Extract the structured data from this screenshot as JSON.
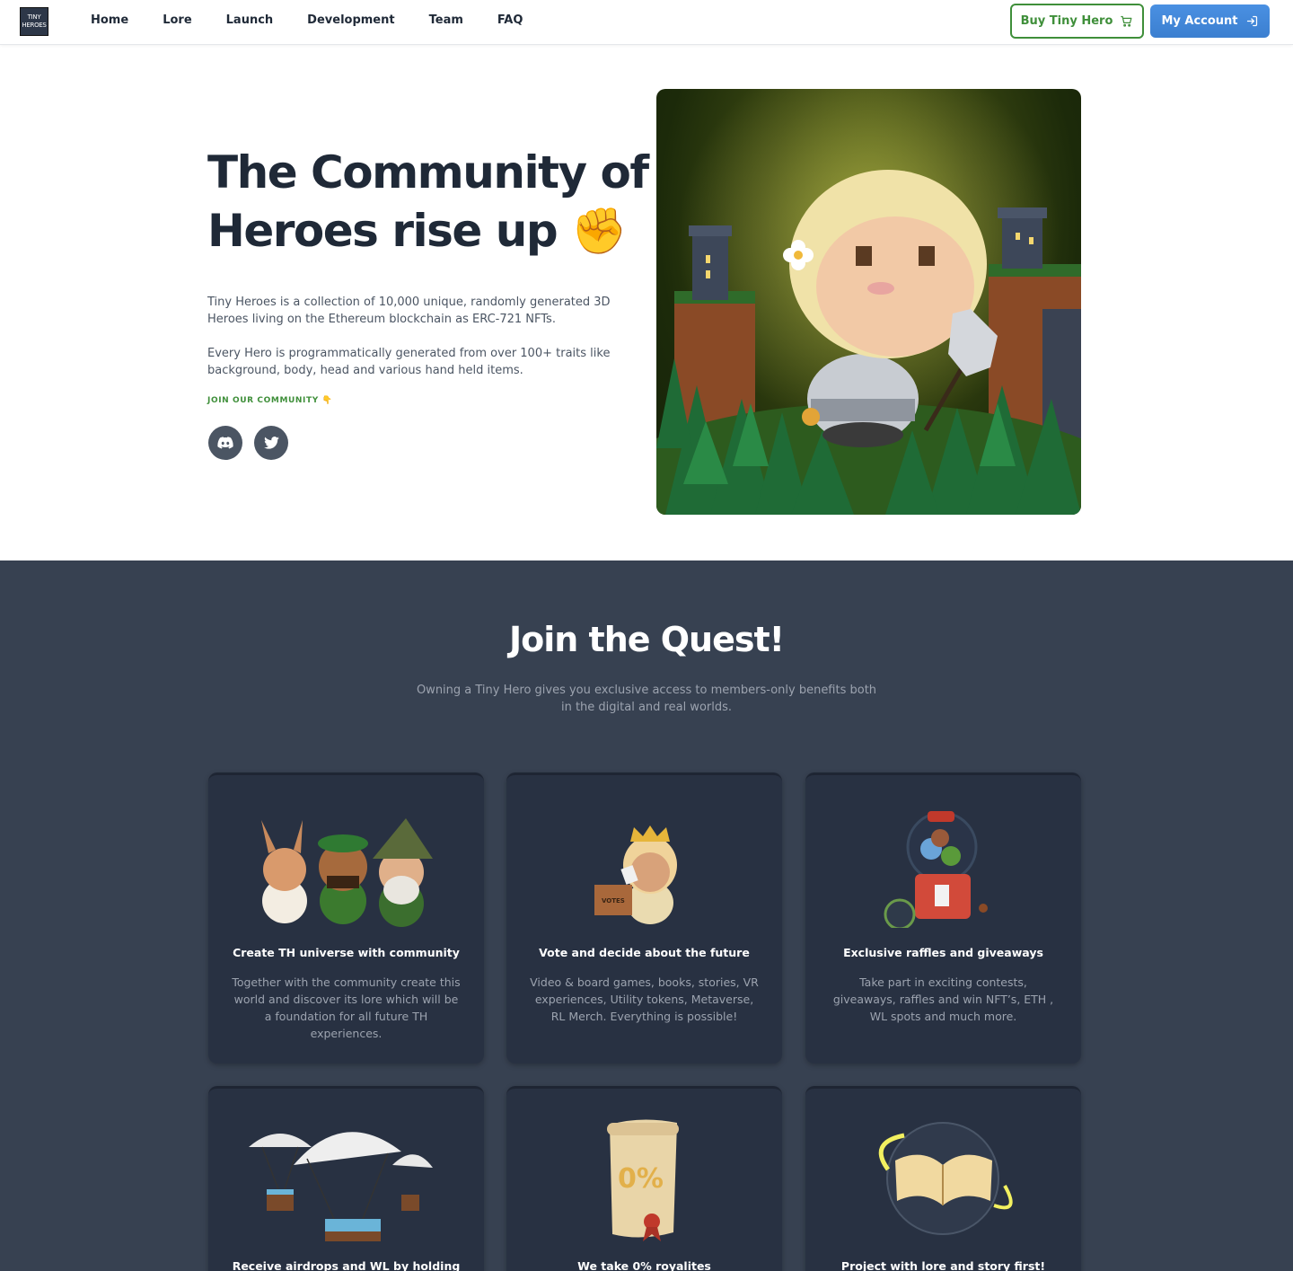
{
  "nav": {
    "logo_lines": [
      "TINY",
      "HEROES"
    ],
    "links": [
      "Home",
      "Lore",
      "Launch",
      "Development",
      "Team",
      "FAQ"
    ],
    "buy_label": "Buy Tiny Hero",
    "account_label": "My Account"
  },
  "hero": {
    "title": "The Community of Heroes rise up ✊",
    "paragraph1": "Tiny Heroes is a collection of 10,000 unique, randomly generated 3D Heroes living on the Ethereum blockchain as ERC-721 NFTs.",
    "paragraph2": "Every Hero is programmatically generated from over 100+ traits like background, body, head and various hand held items.",
    "join_label": "JOIN OUR COMMUNITY 👇",
    "socials": [
      "discord-icon",
      "twitter-icon"
    ]
  },
  "quest": {
    "title": "Join the Quest!",
    "subtitle": "Owning a Tiny Hero gives you exclusive access to members-only benefits both in the digital and real worlds.",
    "cards": [
      {
        "title": "Create TH universe with community",
        "text": "Together with the community create this world and discover its lore which will be a foundation for all future TH experiences."
      },
      {
        "title": "Vote and decide about the future",
        "text": "Video & board games, books, stories, VR experiences, Utility tokens, Metaverse, RL Merch. Everything is possible!",
        "art_label": "VOTES"
      },
      {
        "title": "Exclusive raffles and giveaways",
        "text": "Take part in exciting contests, giveaways, raffles and win NFT’s, ETH , WL spots and much more."
      },
      {
        "title": "Receive airdrops and WL by holding",
        "text": ""
      },
      {
        "title": "We take 0% royalites",
        "text": "",
        "art_label": "0%"
      },
      {
        "title": "Project with lore and story first!",
        "text": ""
      }
    ]
  },
  "colors": {
    "accent_green": "#3f8f3a",
    "accent_blue": "#4a90e2",
    "dark_section": "#374151",
    "card_bg": "#283142"
  }
}
